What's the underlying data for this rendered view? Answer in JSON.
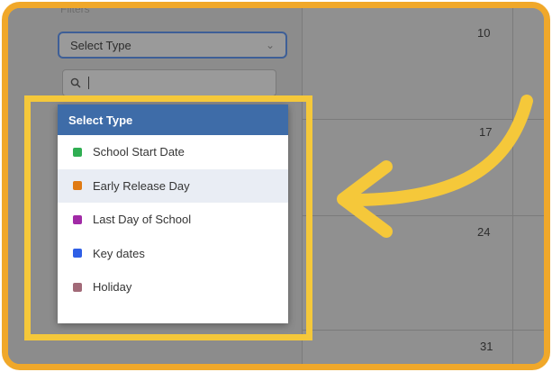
{
  "sidebar": {
    "heading": "Filters",
    "type_select": {
      "label": "Select Type"
    },
    "search": {
      "value": ""
    }
  },
  "calendar": {
    "day_numbers": [
      "10",
      "17",
      "24",
      "31"
    ]
  },
  "dropdown": {
    "header": "Select Type",
    "items": [
      {
        "label": "School Start Date",
        "color": "#2fae52"
      },
      {
        "label": "Early Release Day",
        "color": "#e07a12"
      },
      {
        "label": "Last Day of School",
        "color": "#a12aa6"
      },
      {
        "label": "Key dates",
        "color": "#2f5fe6"
      },
      {
        "label": "Holiday",
        "color": "#a26a78"
      }
    ]
  },
  "annotation": {
    "highlight_color": "#f5c83a",
    "frame_color": "#f0a82a",
    "arrow_color": "#f5c83a"
  }
}
